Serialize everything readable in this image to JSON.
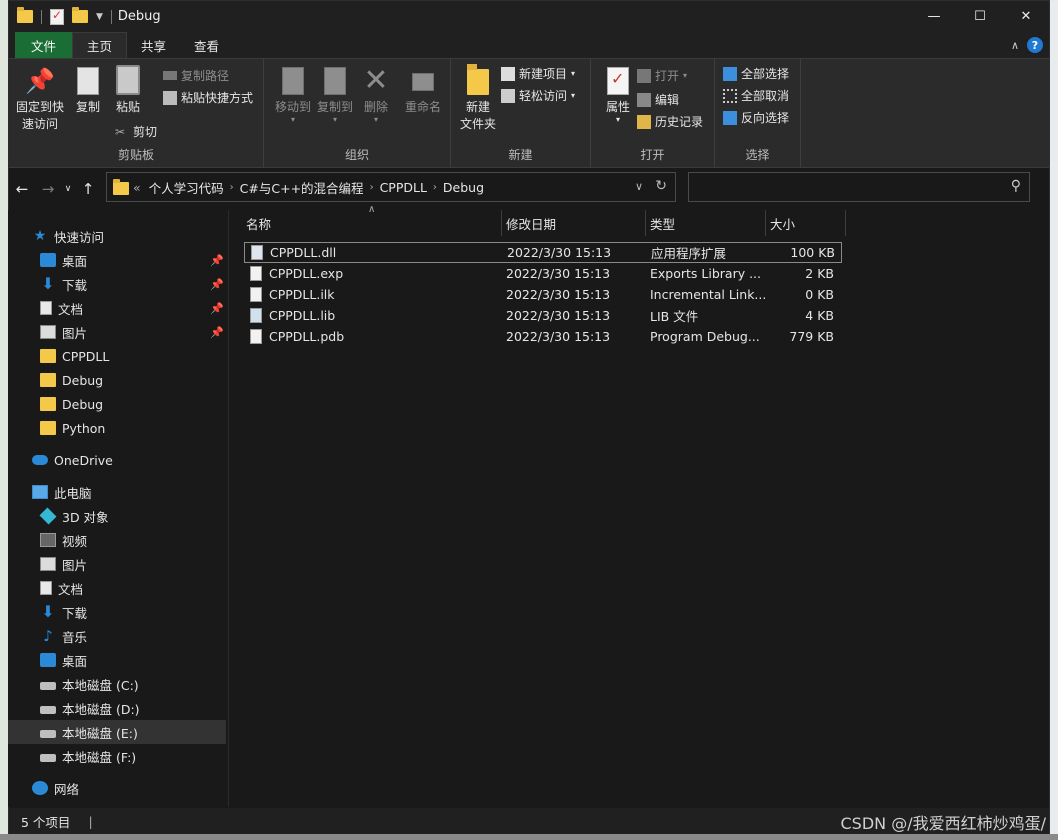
{
  "window": {
    "title": "Debug",
    "controls": {
      "minimize": "—",
      "maximize": "☐",
      "close": "✕"
    }
  },
  "ribbon_tabs": {
    "file": "文件",
    "home": "主页",
    "share": "共享",
    "view": "查看"
  },
  "ribbon": {
    "clipboard": {
      "label": "剪贴板",
      "pin_line1": "固定到快",
      "pin_line2": "速访问",
      "copy": "复制",
      "paste": "粘贴",
      "copy_path": "复制路径",
      "paste_shortcut": "粘贴快捷方式",
      "cut": "剪切"
    },
    "organize": {
      "label": "组织",
      "move_to": "移动到",
      "copy_to": "复制到",
      "delete": "删除",
      "rename": "重命名"
    },
    "new": {
      "label": "新建",
      "new_folder_line1": "新建",
      "new_folder_line2": "文件夹",
      "new_item": "新建项目",
      "easy_access": "轻松访问"
    },
    "open": {
      "label": "打开",
      "properties": "属性",
      "open": "打开",
      "edit": "编辑",
      "history": "历史记录"
    },
    "select": {
      "label": "选择",
      "select_all": "全部选择",
      "select_none": "全部取消",
      "invert": "反向选择"
    }
  },
  "address": {
    "overflow": "«",
    "crumbs": [
      "个人学习代码",
      "C#与C++的混合编程",
      "CPPDLL",
      "Debug"
    ]
  },
  "search": {
    "placeholder": ""
  },
  "nav": {
    "quick_access": "快速访问",
    "qa_items": [
      "桌面",
      "下载",
      "文档",
      "图片",
      "CPPDLL",
      "Debug",
      "Debug",
      "Python"
    ],
    "onedrive": "OneDrive",
    "this_pc": "此电脑",
    "pc_items": [
      "3D 对象",
      "视频",
      "图片",
      "文档",
      "下载",
      "音乐",
      "桌面",
      "本地磁盘 (C:)",
      "本地磁盘 (D:)",
      "本地磁盘 (E:)",
      "本地磁盘 (F:)"
    ],
    "network": "网络"
  },
  "columns": {
    "name": "名称",
    "date": "修改日期",
    "type": "类型",
    "size": "大小"
  },
  "files": [
    {
      "name": "CPPDLL.dll",
      "date": "2022/3/30 15:13",
      "type": "应用程序扩展",
      "size": "100 KB"
    },
    {
      "name": "CPPDLL.exp",
      "date": "2022/3/30 15:13",
      "type": "Exports Library ...",
      "size": "2 KB"
    },
    {
      "name": "CPPDLL.ilk",
      "date": "2022/3/30 15:13",
      "type": "Incremental Link...",
      "size": "0 KB"
    },
    {
      "name": "CPPDLL.lib",
      "date": "2022/3/30 15:13",
      "type": "LIB 文件",
      "size": "4 KB"
    },
    {
      "name": "CPPDLL.pdb",
      "date": "2022/3/30 15:13",
      "type": "Program Debug...",
      "size": "779 KB"
    }
  ],
  "status": {
    "count": "5 个项目",
    "sep": "|"
  },
  "watermark": "CSDN @/我爱西红柿炒鸡蛋/"
}
